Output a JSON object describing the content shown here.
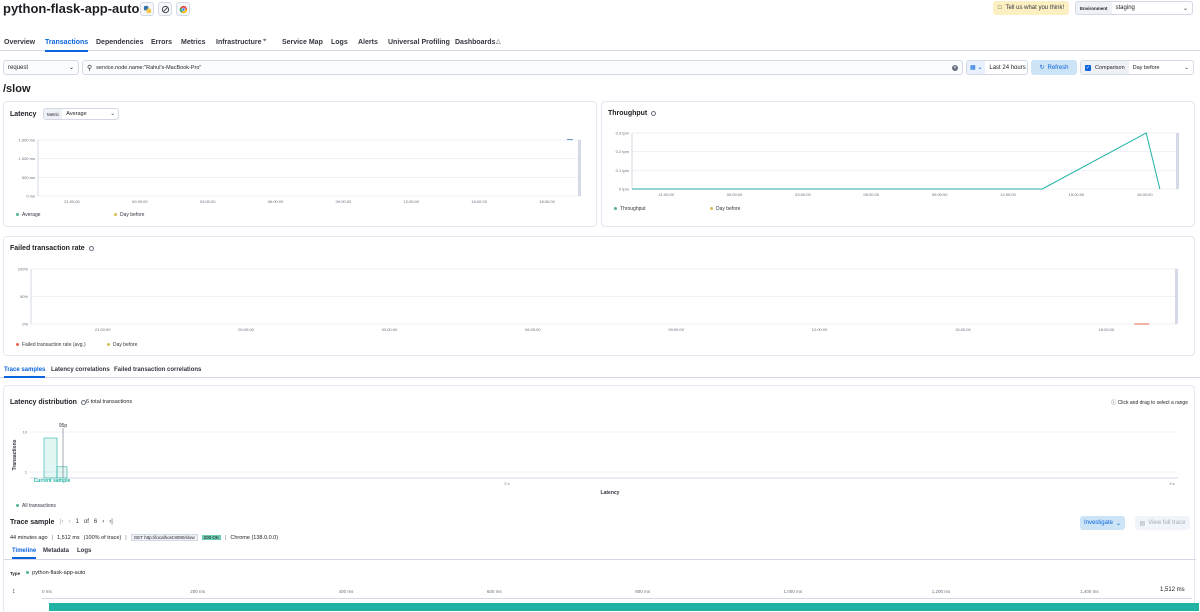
{
  "header": {
    "app_title": "python-flask-app-auto",
    "feedback_label": "Tell us what you think!",
    "environment_label": "Environment",
    "environment_value": "staging"
  },
  "nav": {
    "tabs": [
      "Overview",
      "Transactions",
      "Dependencies",
      "Errors",
      "Metrics",
      "Infrastructure",
      "Service Map",
      "Logs",
      "Alerts",
      "Universal Profiling",
      "Dashboards"
    ],
    "active": "Transactions"
  },
  "filters": {
    "type_value": "request",
    "query_value": "service.node.name:\"Rahul's-MacBook-Pro\"",
    "time_range": "Last 24 hours",
    "refresh_label": "Refresh",
    "comparison_label": "Comparison",
    "comparison_value": "Day before"
  },
  "page": {
    "transaction_name": "/slow"
  },
  "latency": {
    "title": "Latency",
    "metric_label": "Metric",
    "metric_value": "Average",
    "legend": [
      "Average",
      "Day before"
    ]
  },
  "throughput": {
    "title": "Throughput",
    "legend": [
      "Throughput",
      "Day before"
    ]
  },
  "failed": {
    "title": "Failed transaction rate",
    "legend": [
      "Failed transaction rate (avg.)",
      "Day before"
    ]
  },
  "sample_tabs": [
    "Trace samples",
    "Latency correlations",
    "Failed transaction correlations"
  ],
  "distribution": {
    "title": "Latency distribution",
    "count": "6 total transactions",
    "hint": "Click and drag to select a range",
    "percentile": "95p",
    "current_sample": "Current sample",
    "xlabel": "Latency",
    "ylabel": "Transactions",
    "legend": "All transactions"
  },
  "trace": {
    "title": "Trace sample",
    "pager_current": "1",
    "pager_of": "of",
    "pager_total": "6",
    "investigate_label": "Investigate",
    "view_full_label": "View full trace",
    "age": "44 minutes ago",
    "duration": "1,512 ms",
    "percent": "(100% of trace)",
    "request": "GET http://localhost:8090/slow",
    "status": "200 OK",
    "browser": "Chrome (138.0.0.0)",
    "detail_tabs": [
      "Timeline",
      "Metadata",
      "Logs"
    ],
    "type_label": "Type",
    "service": "python-flask-app-auto",
    "ticks": [
      "0 ms",
      "200 ms",
      "400 ms",
      "600 ms",
      "800 ms",
      "1,000 ms",
      "1,200 ms",
      "1,400 ms"
    ],
    "total": "1,512 ms"
  },
  "colors": {
    "accent": "#0b64dd",
    "teal": "#54b399",
    "green_bar": "#20b2a3",
    "status_green": "#6dccb1"
  },
  "chart_data": [
    {
      "type": "line",
      "name": "latency",
      "x": [
        "21:00:00",
        "00:00:00",
        "03:00:00",
        "06:00:00",
        "09:00:00",
        "12:00:00",
        "15:00:00",
        "18:00:00"
      ],
      "yticks": [
        "0 ms",
        "500 ms",
        "1,000 ms",
        "1,500 ms"
      ],
      "ylim": [
        0,
        1500
      ],
      "series": [
        {
          "name": "Average",
          "points": [
            [
              0.985,
              1512
            ]
          ]
        }
      ]
    },
    {
      "type": "line",
      "name": "throughput",
      "x": [
        "21:00:00",
        "00:00:00",
        "03:00:00",
        "06:00:00",
        "09:00:00",
        "12:00:00",
        "15:00:00",
        "18:00:00"
      ],
      "yticks": [
        "0 tpm",
        "0.1 tpm",
        "0.2 tpm",
        "0.3 tpm"
      ],
      "ylim": [
        0,
        0.3
      ],
      "series": [
        {
          "name": "Throughput",
          "values": [
            0,
            0,
            0,
            0,
            0,
            0,
            0,
            0.3,
            0
          ]
        }
      ]
    },
    {
      "type": "line",
      "name": "failed",
      "x": [
        "21:00:00",
        "00:00:00",
        "03:00:00",
        "06:00:00",
        "09:00:00",
        "12:00:00",
        "15:00:00",
        "18:00:00"
      ],
      "yticks": [
        "0%",
        "50%",
        "100%"
      ],
      "ylim": [
        0,
        100
      ],
      "series": [
        {
          "name": "Failed transaction rate (avg.)",
          "values": [
            0
          ]
        }
      ]
    },
    {
      "type": "bar",
      "name": "distribution",
      "xticks": [
        "1 s",
        "2 s",
        "3 s"
      ],
      "yticks": [
        "1",
        "10"
      ],
      "values": [
        5,
        1
      ]
    }
  ]
}
